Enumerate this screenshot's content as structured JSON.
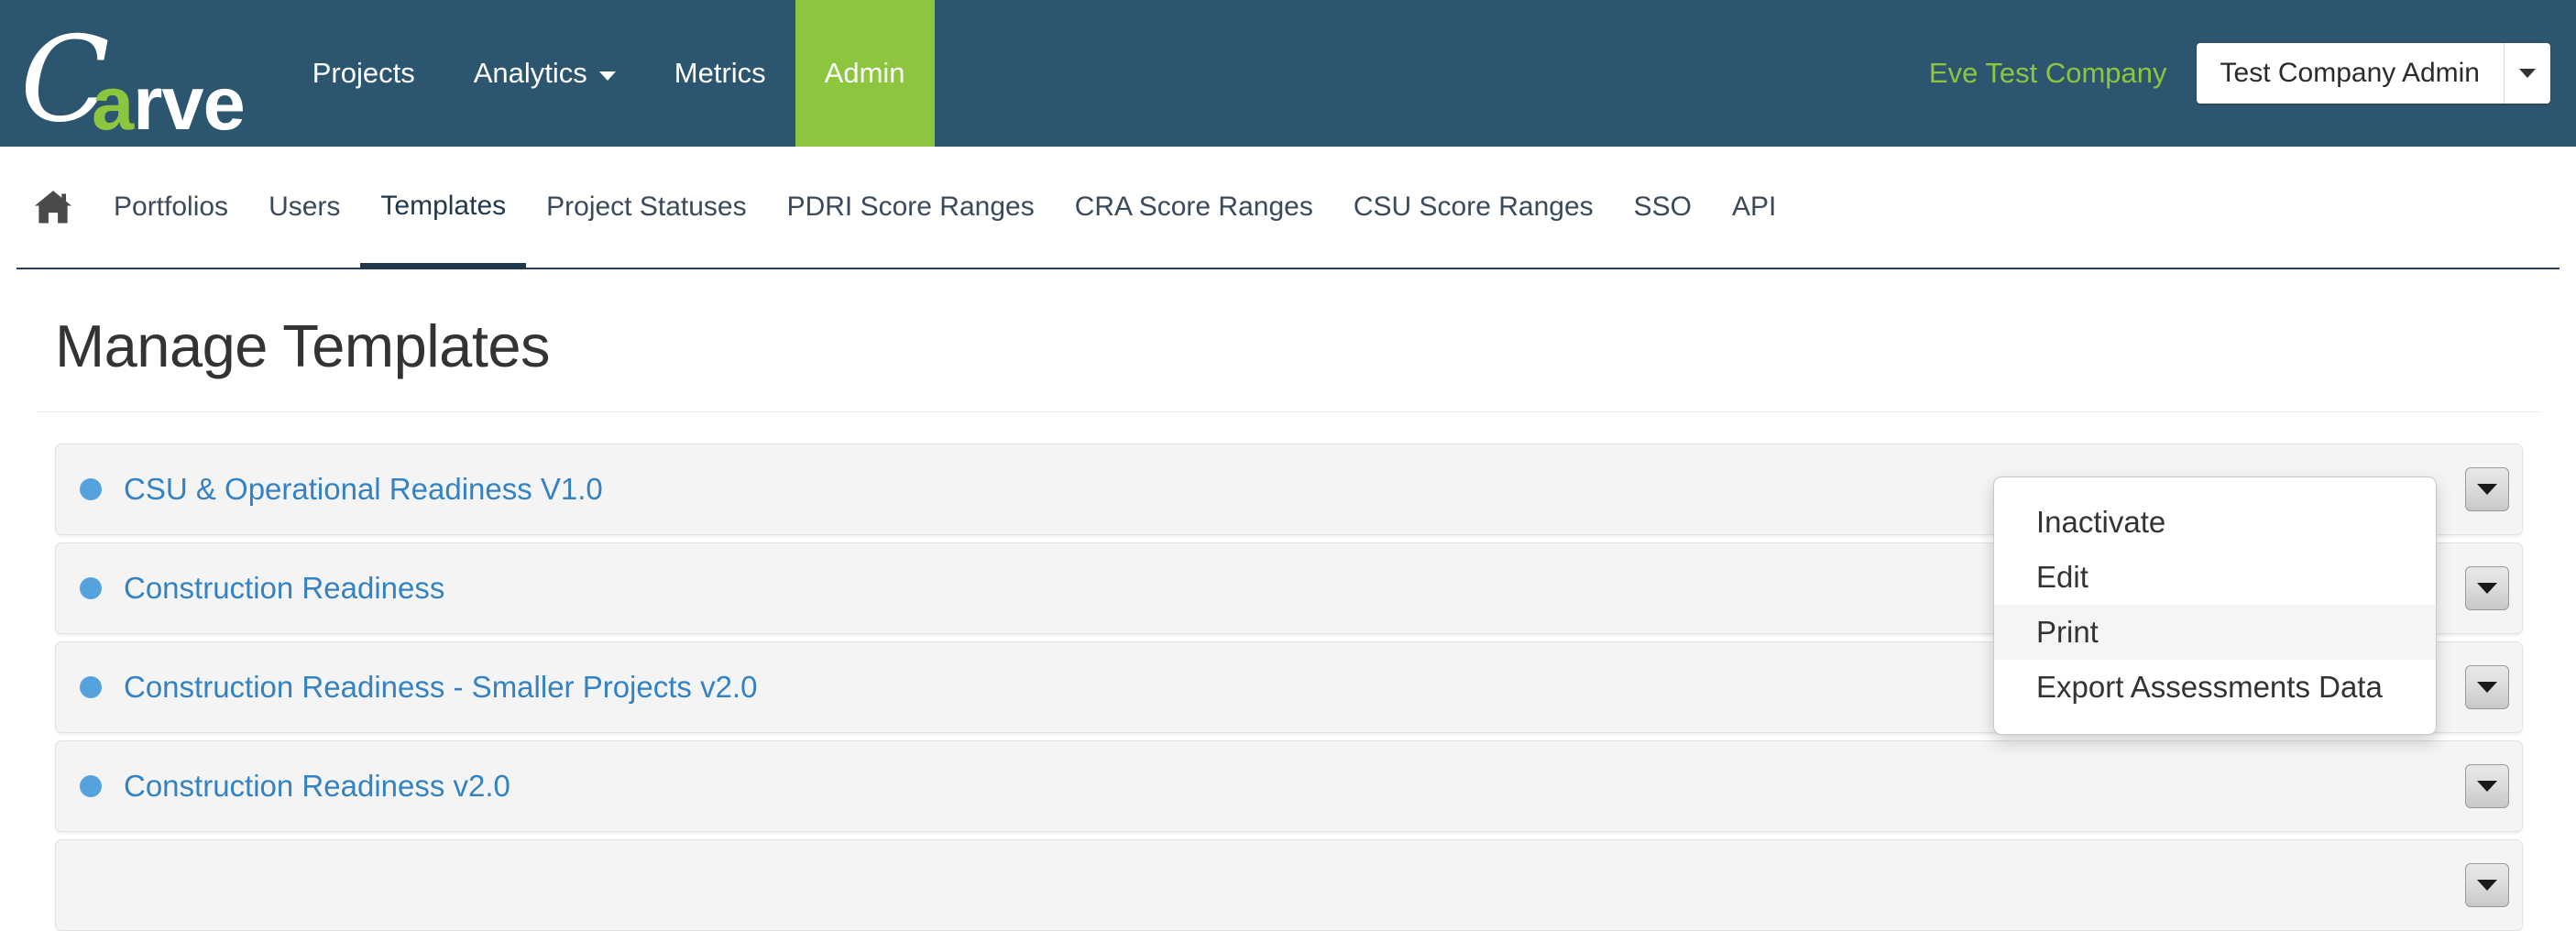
{
  "brand": {
    "logo_first": "C",
    "logo_rest_a": "a",
    "logo_rest_tail": "rve"
  },
  "topnav": {
    "items": [
      {
        "label": "Projects",
        "active": false,
        "has_caret": false
      },
      {
        "label": "Analytics",
        "active": false,
        "has_caret": true
      },
      {
        "label": "Metrics",
        "active": false,
        "has_caret": false
      },
      {
        "label": "Admin",
        "active": true,
        "has_caret": false
      }
    ],
    "company_name": "Eve Test Company",
    "user_button_label": "Test Company Admin"
  },
  "subnav": {
    "home_icon": "home-icon",
    "items": [
      {
        "label": "Portfolios",
        "active": false
      },
      {
        "label": "Users",
        "active": false
      },
      {
        "label": "Templates",
        "active": true
      },
      {
        "label": "Project Statuses",
        "active": false
      },
      {
        "label": "PDRI Score Ranges",
        "active": false
      },
      {
        "label": "CRA Score Ranges",
        "active": false
      },
      {
        "label": "CSU Score Ranges",
        "active": false
      },
      {
        "label": "SSO",
        "active": false
      },
      {
        "label": "API",
        "active": false
      }
    ]
  },
  "page": {
    "title": "Manage Templates"
  },
  "templates": [
    {
      "name": "CSU & Operational Readiness V1.0"
    },
    {
      "name": "Construction Readiness"
    },
    {
      "name": "Construction Readiness - Smaller Projects v2.0"
    },
    {
      "name": "Construction Readiness v2.0"
    },
    {
      "name": ""
    }
  ],
  "dropdown": {
    "open_for_row": 0,
    "items": [
      {
        "label": "Inactivate",
        "hovered": false
      },
      {
        "label": "Edit",
        "hovered": false
      },
      {
        "label": "Print",
        "hovered": true
      },
      {
        "label": "Export Assessments Data",
        "hovered": false
      }
    ]
  },
  "colors": {
    "header_blue": "#2c5570",
    "accent_green": "#8cc63e",
    "link_blue": "#3383c4",
    "bullet_blue": "#55a3dd",
    "row_bg": "#f4f4f4",
    "active_tab_underline": "#20394f"
  }
}
